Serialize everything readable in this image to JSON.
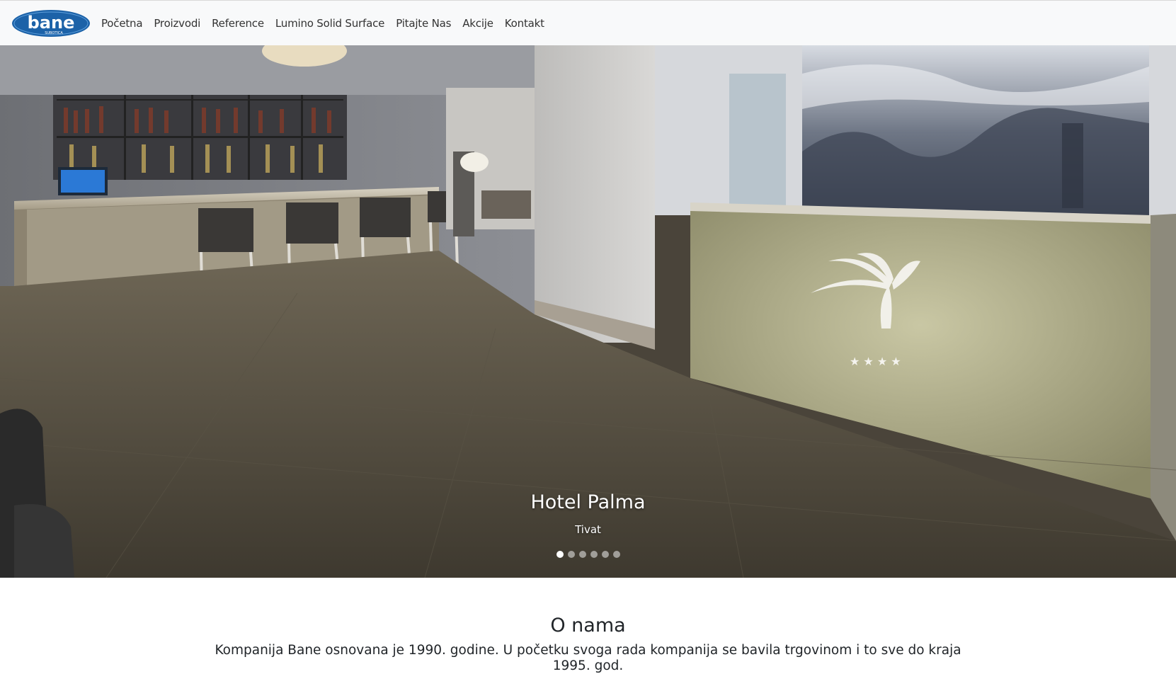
{
  "brand": {
    "logo_text": "bane",
    "logo_subtext": "SUBOTICA",
    "logo_color": "#1c62a8"
  },
  "nav": {
    "items": [
      {
        "label": "Početna"
      },
      {
        "label": "Proizvodi"
      },
      {
        "label": "Reference"
      },
      {
        "label": "Lumino Solid Surface"
      },
      {
        "label": "Pitajte Nas"
      },
      {
        "label": "Akcije"
      },
      {
        "label": "Kontakt"
      }
    ]
  },
  "carousel": {
    "caption_title": "Hotel Palma",
    "caption_subtitle": "Tivat",
    "slide_count": 6,
    "active_index": 0
  },
  "about": {
    "title": "O nama",
    "text": "Kompanija Bane osnovana je 1990. godine. U početku svoga rada kompanija se bavila trgovinom i to sve do kraja 1995. god."
  },
  "colors": {
    "navbar_bg": "#f8f9fa",
    "text": "#212529"
  }
}
